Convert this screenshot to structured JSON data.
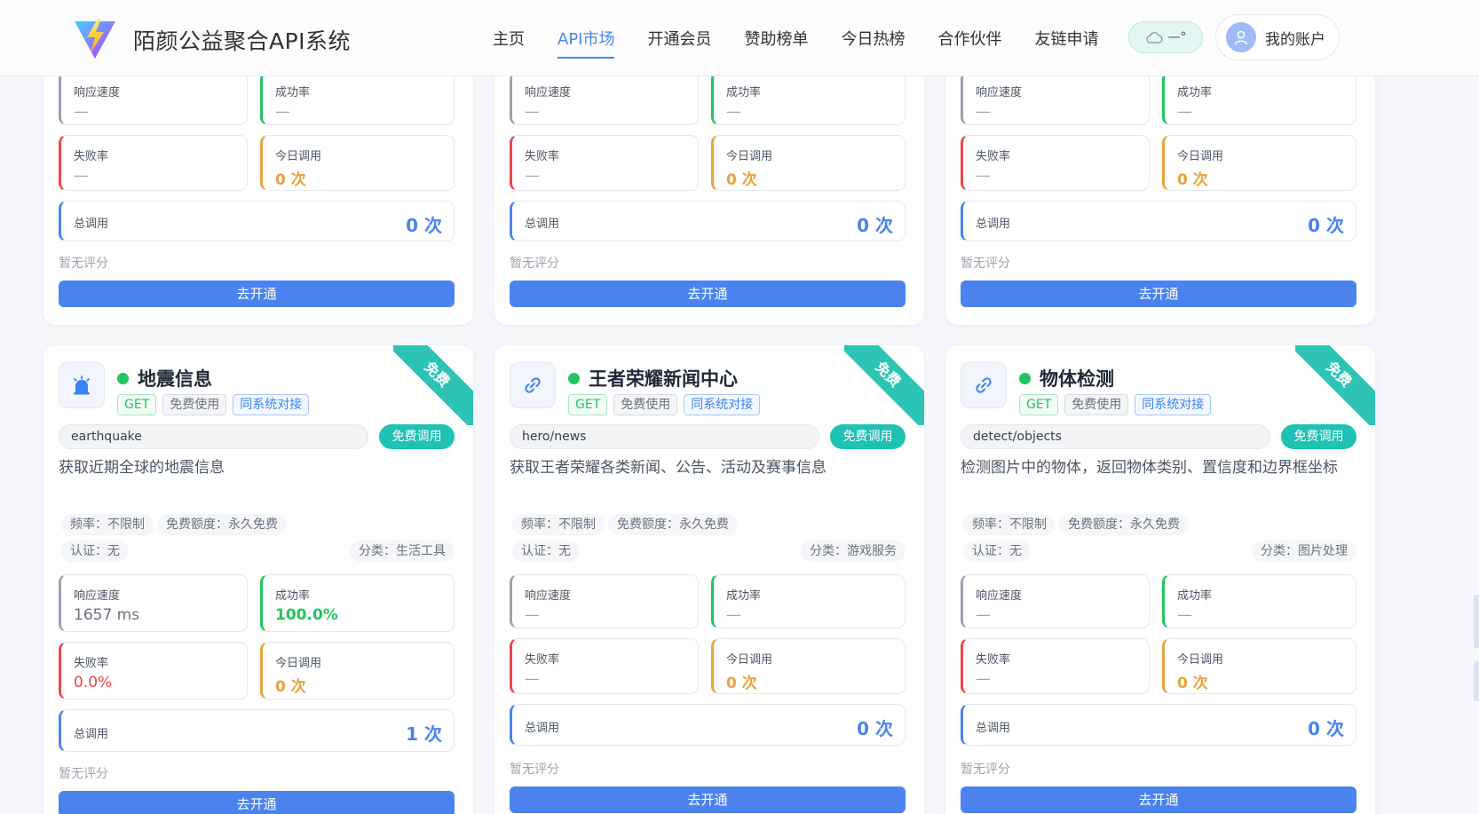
{
  "header": {
    "brand": "陌颜公益聚合API系统",
    "nav": [
      "主页",
      "API市场",
      "开通会员",
      "赞助榜单",
      "今日热榜",
      "合作伙伴",
      "友链申请"
    ],
    "active_nav": 1,
    "weather": "—°",
    "account_label": "我的账户"
  },
  "labels": {
    "response_speed": "响应速度",
    "success_rate": "成功率",
    "failure_rate": "失败率",
    "today_calls": "今日调用",
    "total_calls": "总调用",
    "no_rating": "暂无评分",
    "open_button": "去开通",
    "method": "GET",
    "free_use": "免费使用",
    "same_system": "同系统对接",
    "free_call": "免费调用",
    "ribbon": "免费",
    "frequency": "频率：不限制",
    "quota": "免费额度：永久免费",
    "auth": "认证：无"
  },
  "top_cards": [
    {
      "response": "—",
      "success": "—",
      "failure": "—",
      "today": "0 次",
      "total": "0 次"
    },
    {
      "response": "—",
      "success": "—",
      "failure": "—",
      "today": "0 次",
      "total": "0 次"
    },
    {
      "response": "—",
      "success": "—",
      "failure": "—",
      "today": "0 次",
      "total": "0 次"
    }
  ],
  "cards": [
    {
      "title": "地震信息",
      "icon": "alarm-icon",
      "endpoint": "earthquake",
      "desc": "获取近期全球的地震信息",
      "category": "分类：生活工具",
      "response": "1657 ms",
      "success": "100.0%",
      "failure": "0.0%",
      "today": "0 次",
      "total": "1 次"
    },
    {
      "title": "王者荣耀新闻中心",
      "icon": "link-icon",
      "endpoint": "hero/news",
      "desc": "获取王者荣耀各类新闻、公告、活动及赛事信息",
      "category": "分类：游戏服务",
      "response": "—",
      "success": "—",
      "failure": "—",
      "today": "0 次",
      "total": "0 次"
    },
    {
      "title": "物体检测",
      "icon": "link-icon",
      "endpoint": "detect/objects",
      "desc": "检测图片中的物体，返回物体类别、置信度和边界框坐标",
      "category": "分类：图片处理",
      "response": "—",
      "success": "—",
      "failure": "—",
      "today": "0 次",
      "total": "0 次"
    }
  ],
  "colors": {
    "accent": "#4a83f0",
    "green": "#22c55e",
    "red": "#ef4444",
    "orange": "#e8a33d",
    "teal": "#20c2b4",
    "gray_border": "#9ca3af"
  }
}
